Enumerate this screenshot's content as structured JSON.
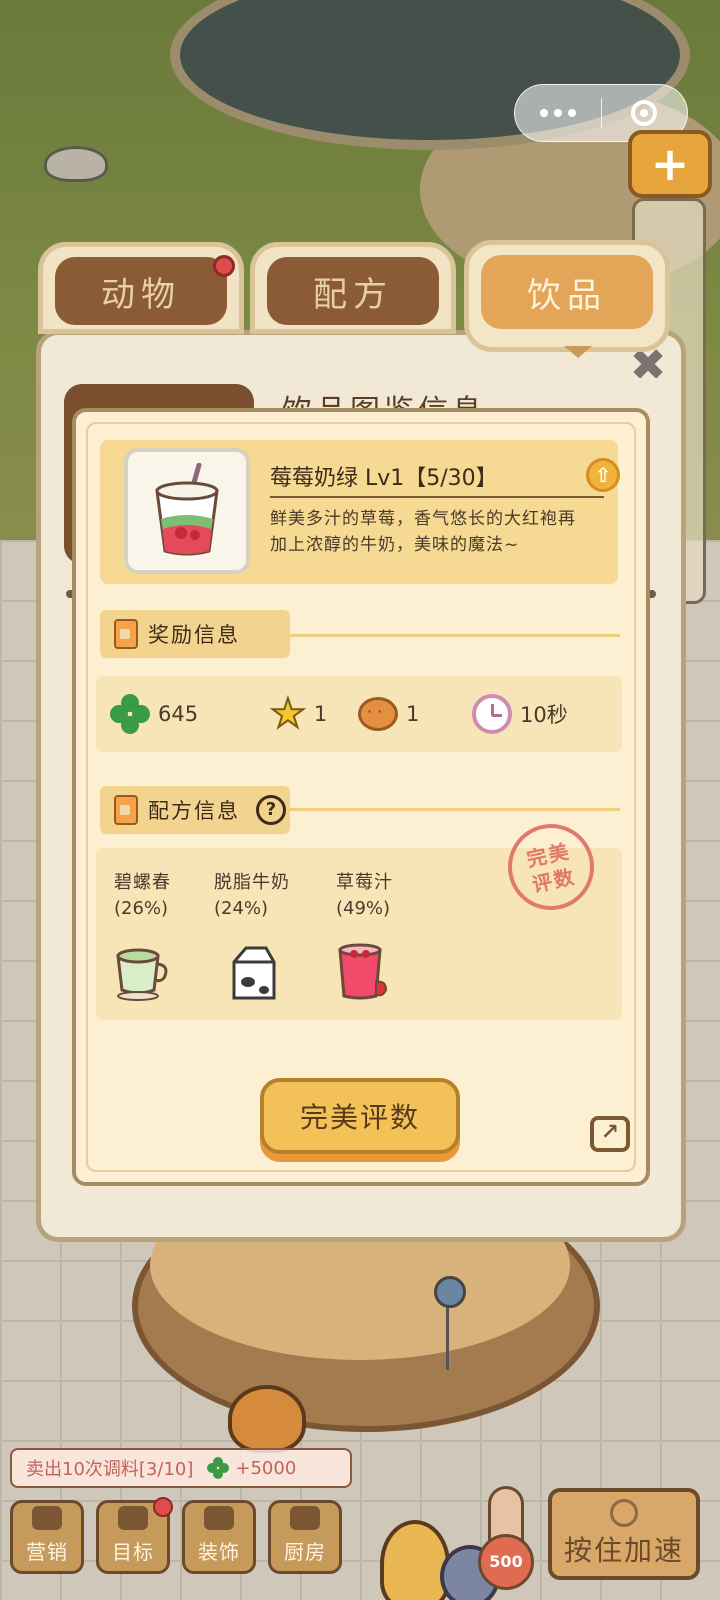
{
  "tabs": [
    {
      "label": "动物",
      "has_badge": true
    },
    {
      "label": "配方",
      "has_badge": false
    },
    {
      "label": "饮品",
      "has_badge": false,
      "active": true
    }
  ],
  "outer_panel": {
    "title": "饮品图鉴信息"
  },
  "drink": {
    "name": "莓莓奶绿 Lv1【5/30】",
    "description": "鲜美多汁的草莓，香气悠长的大红袍再加上浓醇的牛奶，美味的魔法~"
  },
  "reward": {
    "header": "奖励信息",
    "items": [
      {
        "icon": "clover-icon",
        "value": "645"
      },
      {
        "icon": "star-icon",
        "value": "1"
      },
      {
        "icon": "cookie-icon",
        "value": "1"
      },
      {
        "icon": "clock-icon",
        "value": "10秒"
      }
    ]
  },
  "recipe": {
    "header": "配方信息",
    "ingredients": [
      {
        "name": "碧螺春",
        "percent": "(26%)",
        "icon": "tea-cup-icon"
      },
      {
        "name": "脱脂牛奶",
        "percent": "(24%)",
        "icon": "milk-carton-icon"
      },
      {
        "name": "草莓汁",
        "percent": "(49%)",
        "icon": "strawberry-juice-icon"
      }
    ],
    "stamp_line1": "完美",
    "stamp_line2": "评数"
  },
  "actions": {
    "perfect_label": "完美评数"
  },
  "hud": {
    "quest_text": "卖出10次调料[3/10]",
    "quest_reward": "+5000",
    "buttons": [
      {
        "label": "营销",
        "has_badge": false
      },
      {
        "label": "目标",
        "has_badge": true
      },
      {
        "label": "装饰",
        "has_badge": false
      },
      {
        "label": "厨房",
        "has_badge": false
      }
    ],
    "temperature": "500",
    "speed_label": "按住加速"
  },
  "colors": {
    "accent": "#f2c258",
    "tab_active": "#e3a659",
    "tab_inactive": "#8a5b35",
    "badge": "#e04b4b",
    "stamp": "#e07a6c"
  }
}
